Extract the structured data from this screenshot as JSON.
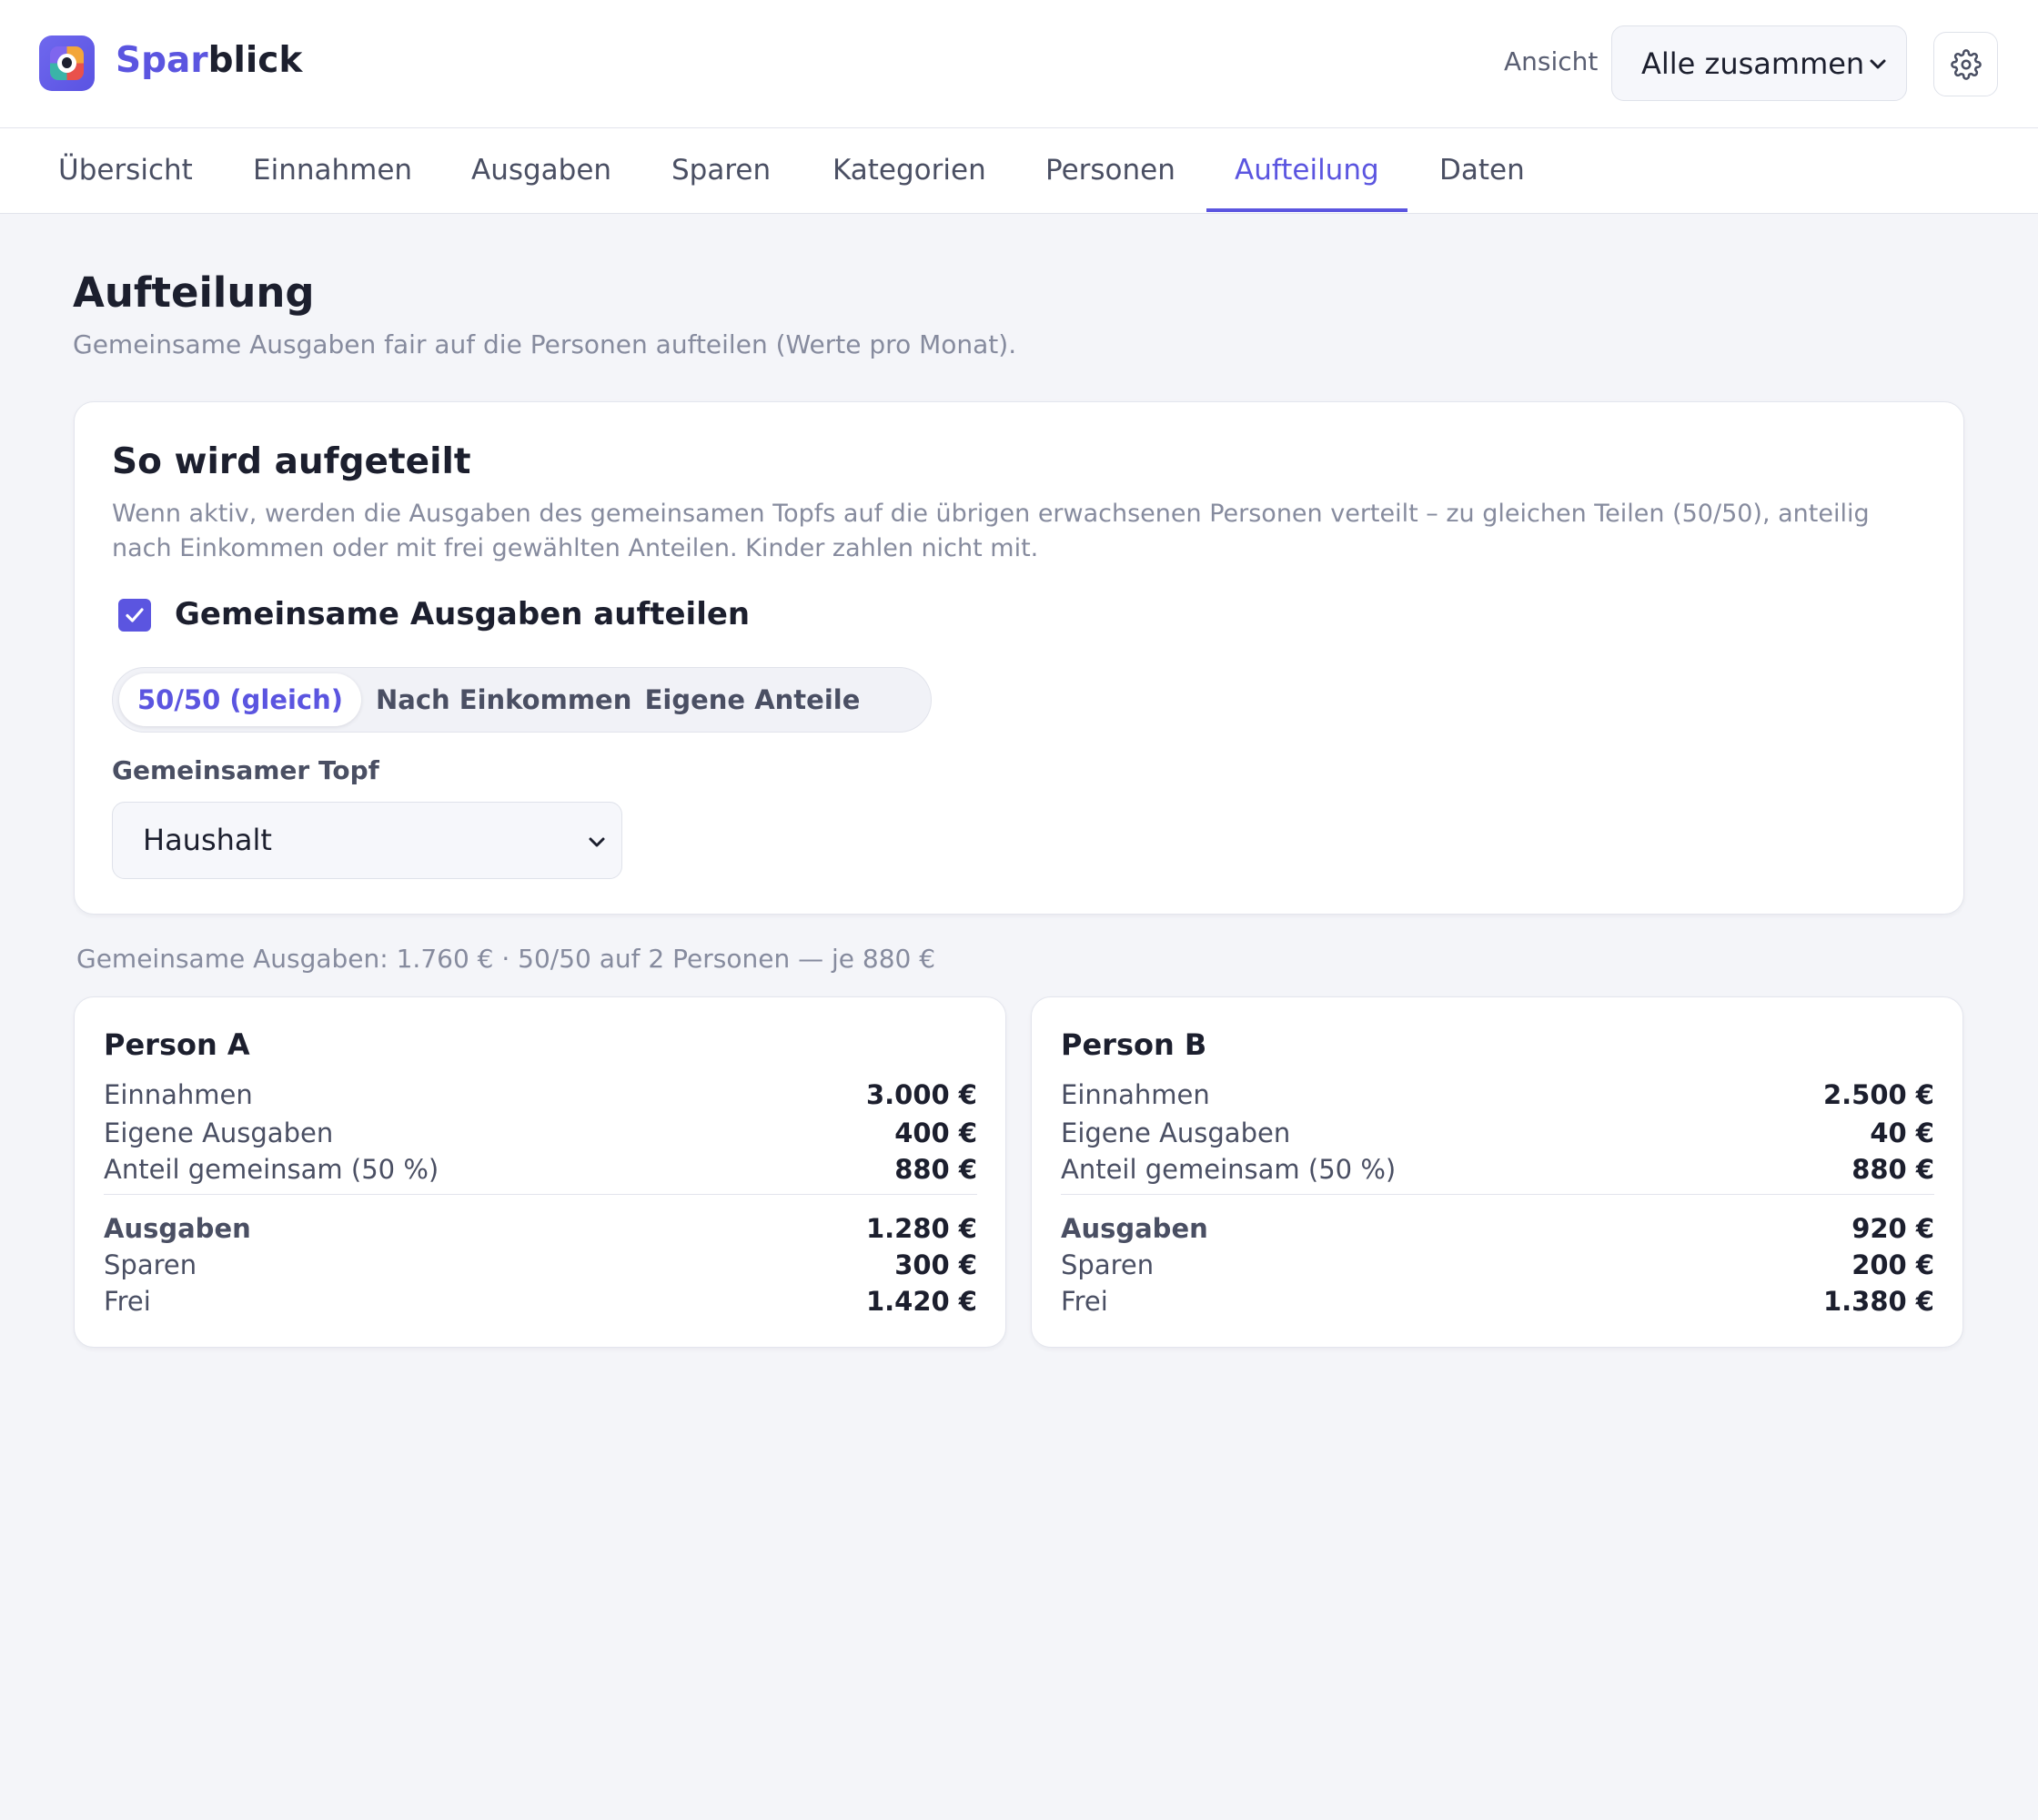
{
  "app": {
    "brand_part1": "Spar",
    "brand_part2": "blick",
    "view_label": "Ansicht",
    "view_value": "Alle zusammen",
    "icons": {
      "logo": "sparblick-logo-icon",
      "settings": "gear-icon",
      "dropdown": "chevron-down-icon"
    },
    "colors": {
      "accent": "#5b55e0",
      "background": "#f4f5f9",
      "text": "#1c1f2e",
      "muted": "#868b9e"
    }
  },
  "tabs": [
    {
      "label": "Übersicht",
      "active": false
    },
    {
      "label": "Einnahmen",
      "active": false
    },
    {
      "label": "Ausgaben",
      "active": false
    },
    {
      "label": "Sparen",
      "active": false
    },
    {
      "label": "Kategorien",
      "active": false
    },
    {
      "label": "Personen",
      "active": false
    },
    {
      "label": "Aufteilung",
      "active": true
    },
    {
      "label": "Daten",
      "active": false
    }
  ],
  "page": {
    "title": "Aufteilung",
    "subtitle": "Gemeinsame Ausgaben fair auf die Personen aufteilen (Werte pro Monat)."
  },
  "split_card": {
    "title": "So wird aufgeteilt",
    "description": "Wenn aktiv, werden die Ausgaben des gemeinsamen Topfs auf die übrigen erwachsenen Personen verteilt – zu gleichen Teilen (50/50), anteilig nach Einkommen oder mit frei gewählten Anteilen. Kinder zahlen nicht mit.",
    "checkbox_label": "Gemeinsame Ausgaben aufteilen",
    "checkbox_checked": true,
    "modes": [
      {
        "label": "50/50 (gleich)",
        "active": true
      },
      {
        "label": "Nach Einkommen",
        "active": false
      },
      {
        "label": "Eigene Anteile",
        "active": false
      }
    ],
    "pot_label": "Gemeinsamer Topf",
    "pot_value": "Haushalt"
  },
  "summary": "Gemeinsame Ausgaben: 1.760 € · 50/50 auf 2 Personen — je 880 €",
  "persons": [
    {
      "name": "Person A",
      "rows": [
        {
          "label": "Einnahmen",
          "value": "3.000 €"
        },
        {
          "label": "Eigene Ausgaben",
          "value": "400 €"
        },
        {
          "label": "Anteil gemeinsam (50 %)",
          "value": "880 €"
        }
      ],
      "totals": [
        {
          "label": "Ausgaben",
          "value": "1.280 €"
        },
        {
          "label": "Sparen",
          "value": "300 €"
        },
        {
          "label": "Frei",
          "value": "1.420 €"
        }
      ]
    },
    {
      "name": "Person B",
      "rows": [
        {
          "label": "Einnahmen",
          "value": "2.500 €"
        },
        {
          "label": "Eigene Ausgaben",
          "value": "40 €"
        },
        {
          "label": "Anteil gemeinsam (50 %)",
          "value": "880 €"
        }
      ],
      "totals": [
        {
          "label": "Ausgaben",
          "value": "920 €"
        },
        {
          "label": "Sparen",
          "value": "200 €"
        },
        {
          "label": "Frei",
          "value": "1.380 €"
        }
      ]
    }
  ]
}
